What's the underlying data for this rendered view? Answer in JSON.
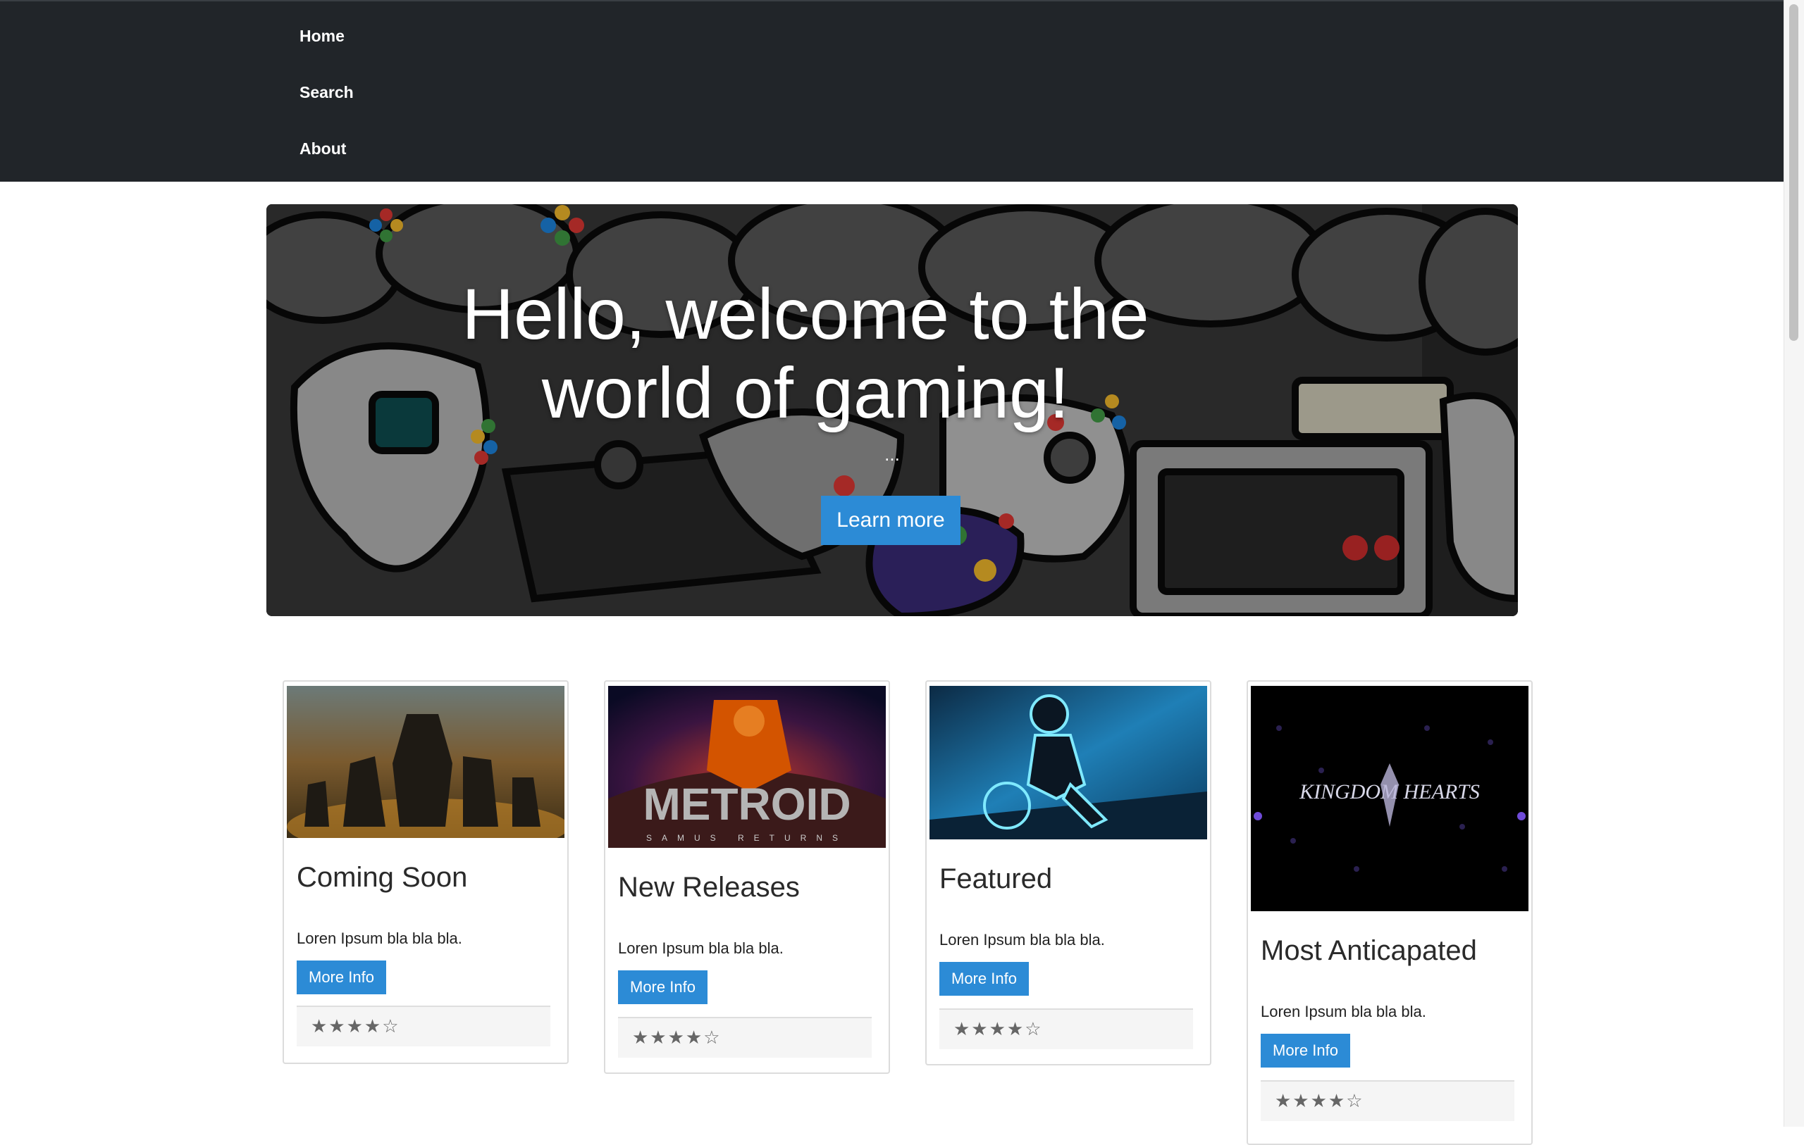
{
  "nav": {
    "items": [
      {
        "label": "Home"
      },
      {
        "label": "Search"
      },
      {
        "label": "About"
      }
    ]
  },
  "hero": {
    "title": "Hello, welcome to the world of gaming!",
    "dots": "...",
    "button_label": "Learn more"
  },
  "cards": [
    {
      "title": "Coming Soon",
      "text": "Loren Ipsum bla bla bla.",
      "button_label": "More Info",
      "rating": "★★★★☆",
      "image": "gears-of-war-art"
    },
    {
      "title": "New Releases",
      "text": "Loren Ipsum bla bla bla.",
      "button_label": "More Info",
      "rating": "★★★★☆",
      "image": "metroid-samus-returns-art",
      "image_text": "METROID",
      "image_subtext": "SAMUS RETURNS"
    },
    {
      "title": "Featured",
      "text": "Loren Ipsum bla bla bla.",
      "button_label": "More Info",
      "rating": "★★★★☆",
      "image": "tron-art"
    },
    {
      "title": "Most Anticapated",
      "text": "Loren Ipsum bla bla bla.",
      "button_label": "More Info",
      "rating": "★★★★☆",
      "image": "kingdom-hearts-art",
      "image_text": "KINGDOM HEARTS"
    }
  ],
  "colors": {
    "nav_bg": "#212529",
    "accent": "#2c8bd6"
  }
}
